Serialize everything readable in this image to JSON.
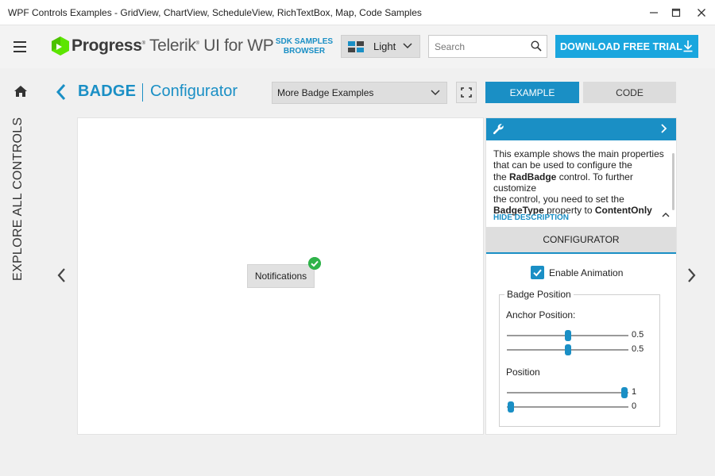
{
  "window": {
    "title": "WPF Controls Examples - GridView, ChartView, ScheduleView, RichTextBox, Map, Code Samples",
    "minimize_glyph": "—",
    "maximize_glyph": "☐",
    "close_glyph": "✕"
  },
  "header": {
    "brand_progress": "Progress",
    "brand_telerik": "Telerik",
    "brand_product": "UI for WP",
    "sdk_line1": "SDK SAMPLES",
    "sdk_line2": "BROWSER",
    "theme_label": "Light",
    "search_placeholder": "Search",
    "trial_label": "DOWNLOAD FREE TRIAL"
  },
  "nav": {
    "explore_label": "EXPLORE ALL CONTROLS"
  },
  "breadcrumb": {
    "control": "BADGE",
    "page": "Configurator"
  },
  "toolbar": {
    "examples_dropdown": "More Badge Examples",
    "tab_example": "EXAMPLE",
    "tab_code": "CODE"
  },
  "example": {
    "host_label": "Notifications"
  },
  "side_panel": {
    "desc_line1": "This example shows the main properties",
    "desc_line2": "that can be used to configure the",
    "desc_bold1": "RadBadge",
    "desc_line3": " control. To further customize",
    "desc_line4": "the control, you need to set the",
    "desc_bold2": "BadgeType",
    "desc_line5": " property to ",
    "desc_bold3": "ContentOnly",
    "hide_description": "HIDE DESCRIPTION",
    "configurator_header": "CONFIGURATOR",
    "enable_animation": "Enable Animation",
    "enable_animation_checked": true,
    "group_title": "Badge Position",
    "anchor_label": "Anchor Position:",
    "anchor_x": "0.5",
    "anchor_y": "0.5",
    "position_label": "Position",
    "position_x": "1",
    "position_y": "0"
  },
  "colors": {
    "accent": "#1a8fc5",
    "trial": "#1aa6de",
    "badge_green": "#2fb34a"
  }
}
